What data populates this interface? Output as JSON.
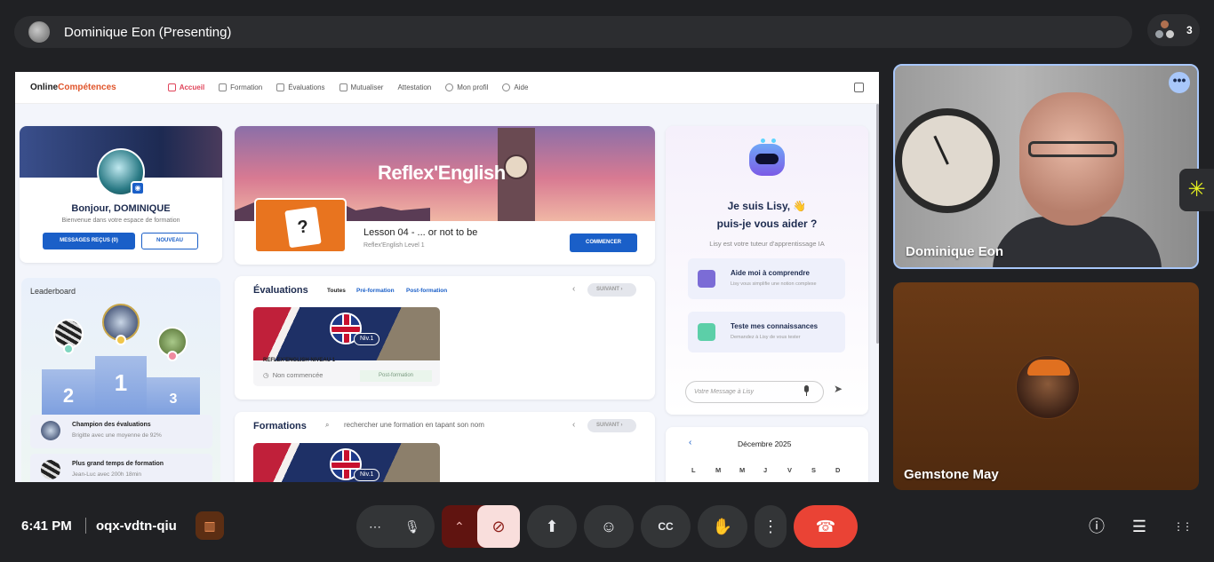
{
  "meet": {
    "presenter_title": "Dominique Eon (Presenting)",
    "participant_count": "3",
    "time": "6:41 PM",
    "meeting_code": "oqx-vdtn-qiu",
    "tiles": [
      {
        "name": "Dominique Eon"
      },
      {
        "name": "Gemstone May"
      }
    ],
    "more_options_glyph": "•••",
    "controls": {
      "more": "⋯",
      "mic": "🎙",
      "chevron": "⌃",
      "camera_off": "⊘",
      "present": "⬆",
      "emoji": "☺",
      "captions": "CC",
      "raise_hand": "✋",
      "kebab": "⋮",
      "end_call": "☎"
    },
    "right_icons": {
      "info": "ⓘ",
      "chat": "☰",
      "apps": "⋮⋮"
    },
    "icons": [
      "presenter-avatar",
      "people-icon",
      "host-controls-icon",
      "sparkle-icon"
    ],
    "colors": {
      "end_call": "#ea4335",
      "camera_off_bg": "#f9dedc",
      "active_speaker_border": "#a8c7fa"
    }
  },
  "app": {
    "brand_part1": "Online",
    "brand_part2": "Compétences",
    "nav": [
      "Accueil",
      "Formation",
      "Évaluations",
      "Mutualiser",
      "Attestation",
      "Mon profil",
      "Aide"
    ],
    "profile": {
      "greeting": "Bonjour, DOMINIQUE",
      "subtitle": "Bienvenue dans votre espace de formation",
      "btn_messages": "MESSAGES REÇUS (0)",
      "btn_new": "NOUVEAU"
    },
    "leaderboard": {
      "title": "Leaderboard",
      "ranks": [
        "2",
        "1",
        "3"
      ],
      "rows": [
        {
          "title": "Champion des évaluations",
          "sub": "Brigitte avec une moyenne de 92%"
        },
        {
          "title": "Plus grand temps de formation",
          "sub": "Jean-Luc avec 200h 18min"
        }
      ]
    },
    "lesson": {
      "banner_title": "Reflex'English",
      "title": "Lesson 04 - ... or not to be",
      "subtitle": "Reflex'English Level 1",
      "cta": "COMMENCER"
    },
    "evaluations": {
      "title": "Évaluations",
      "filters": [
        "Toutes",
        "Pré-formation",
        "Post-formation"
      ],
      "next": "SUIVANT",
      "course": {
        "level": "Niv.1",
        "title": "REFLEX'ENGLISH NIVEAU 1",
        "status": "Non commencée",
        "tag": "Post-formation"
      }
    },
    "formations": {
      "title": "Formations",
      "search_placeholder": "rechercher une formation en tapant son nom",
      "next": "SUIVANT",
      "course_level": "Niv.1"
    },
    "lisy": {
      "heading_line1": "Je suis Lisy, 👋",
      "heading_line2": "puis-je vous aider ?",
      "subtitle": "Lisy est votre tuteur d'apprentissage IA",
      "actions": [
        {
          "title": "Aide moi à comprendre",
          "sub": "Lisy vous simplifie une notion complexe"
        },
        {
          "title": "Teste mes connaissances",
          "sub": "Demandez à Lisy de vous tester"
        }
      ],
      "input_placeholder": "Votre Message à Lisy"
    },
    "calendar": {
      "month": "Décembre 2025",
      "days": [
        "L",
        "M",
        "M",
        "J",
        "V",
        "S",
        "D"
      ]
    },
    "colors": {
      "primary": "#1a5fc8",
      "accent": "#e0552b",
      "nav_active": "#e0445a"
    }
  }
}
